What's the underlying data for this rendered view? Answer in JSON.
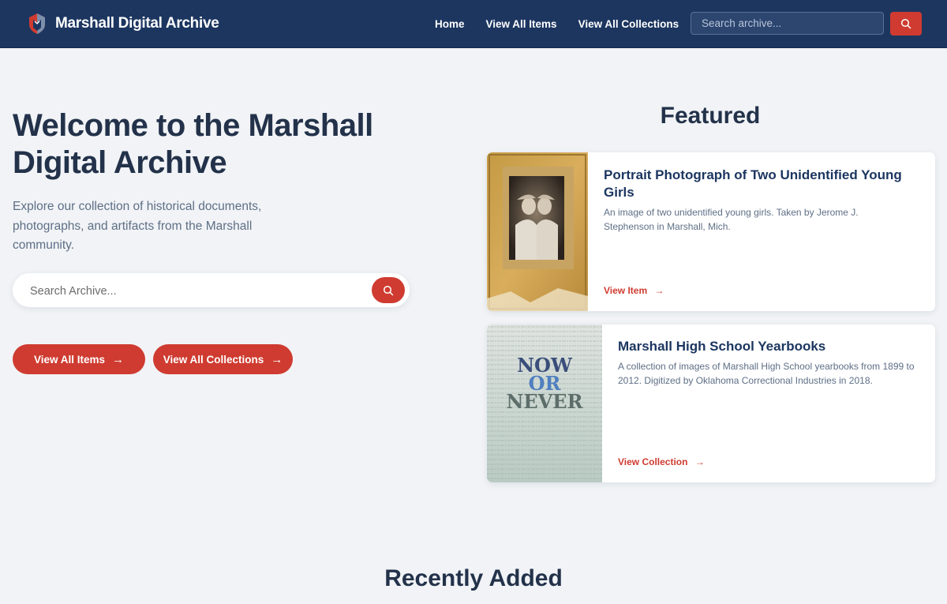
{
  "header": {
    "brand_name": "Marshall Digital Archive",
    "nav": [
      "Home",
      "View All Items",
      "View All Collections"
    ],
    "search_placeholder": "Search archive..."
  },
  "hero": {
    "title": "Welcome to the Marshall Digital Archive",
    "subtitle": "Explore our collection of historical documents, photographs, and artifacts from the Marshall community.",
    "search_placeholder": "Search Archive...",
    "buttons": [
      "View All Items",
      "View All Collections"
    ]
  },
  "featured": {
    "heading": "Featured",
    "cards": [
      {
        "title": "Portrait Photograph of Two Unidentified Young Girls",
        "description": "An image of two unidentified young girls. Taken by Jerome J. Stephenson in Marshall, Mich.",
        "link": "View Item"
      },
      {
        "title": "Marshall High School Yearbooks",
        "description": "A collection of images of Marshall High School yearbooks from 1899 to 2012. Digitized by Oklahoma Correctional Industries in 2018.",
        "link": "View Collection",
        "image_text": [
          "NOW",
          "OR",
          "NEVER"
        ]
      }
    ]
  },
  "recent": {
    "heading": "Recently Added"
  },
  "colors": {
    "navy": "#1c3660",
    "accent": "#cf3b30",
    "page_bg": "#f1f3f6"
  }
}
